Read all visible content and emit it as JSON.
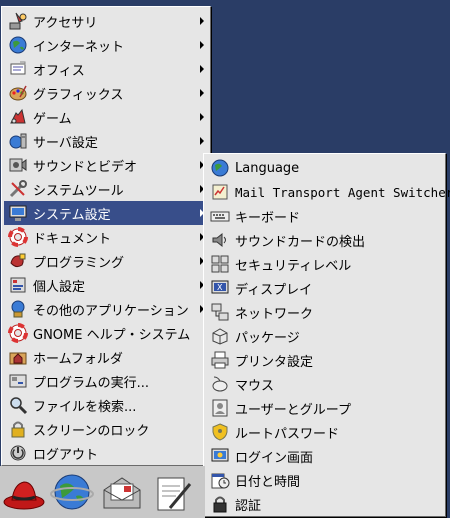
{
  "main_menu": {
    "items": [
      {
        "label": "アクセサリ",
        "icon": "accessories-icon",
        "submenu": true
      },
      {
        "label": "インターネット",
        "icon": "internet-globe-icon",
        "submenu": true
      },
      {
        "label": "オフィス",
        "icon": "office-icon",
        "submenu": true
      },
      {
        "label": "グラフィックス",
        "icon": "graphics-palette-icon",
        "submenu": true
      },
      {
        "label": "ゲーム",
        "icon": "games-icon",
        "submenu": true
      },
      {
        "label": "サーバ設定",
        "icon": "server-settings-icon",
        "submenu": true
      },
      {
        "label": "サウンドとビデオ",
        "icon": "sound-video-icon",
        "submenu": true
      },
      {
        "label": "システムツール",
        "icon": "system-tools-icon",
        "submenu": true
      },
      {
        "label": "システム設定",
        "icon": "system-settings-icon",
        "submenu": true,
        "selected": true
      },
      {
        "label": "ドキュメント",
        "icon": "documents-lifebuoy-icon",
        "submenu": true
      },
      {
        "label": "プログラミング",
        "icon": "programming-icon",
        "submenu": true
      },
      {
        "label": "個人設定",
        "icon": "preferences-icon",
        "submenu": true
      },
      {
        "label": "その他のアプリケーション",
        "icon": "other-apps-icon",
        "submenu": true
      },
      {
        "label": "GNOME ヘルプ・システム",
        "icon": "help-lifebuoy-icon",
        "submenu": false
      },
      {
        "label": "ホームフォルダ",
        "icon": "home-folder-icon",
        "submenu": false
      },
      {
        "label": "プログラムの実行...",
        "icon": "run-program-icon",
        "submenu": false
      },
      {
        "label": "ファイルを検索...",
        "icon": "search-icon",
        "submenu": false
      },
      {
        "label": "スクリーンのロック",
        "icon": "lock-icon",
        "submenu": false
      },
      {
        "label": "ログアウト",
        "icon": "logout-icon",
        "submenu": false
      }
    ]
  },
  "submenu": {
    "items": [
      {
        "label": "Language",
        "icon": "language-globe-icon"
      },
      {
        "label": "Mail Transport Agent Switcher",
        "icon": "mail-switcher-icon"
      },
      {
        "label": "キーボード",
        "icon": "keyboard-icon"
      },
      {
        "label": "サウンドカードの検出",
        "icon": "soundcard-icon"
      },
      {
        "label": "セキュリティレベル",
        "icon": "security-level-icon"
      },
      {
        "label": "ディスプレイ",
        "icon": "display-icon"
      },
      {
        "label": "ネットワーク",
        "icon": "network-icon"
      },
      {
        "label": "パッケージ",
        "icon": "packages-icon"
      },
      {
        "label": "プリンタ設定",
        "icon": "printer-icon"
      },
      {
        "label": "マウス",
        "icon": "mouse-icon"
      },
      {
        "label": "ユーザーとグループ",
        "icon": "users-groups-icon"
      },
      {
        "label": "ルートパスワード",
        "icon": "root-password-icon"
      },
      {
        "label": "ログイン画面",
        "icon": "login-screen-icon"
      },
      {
        "label": "日付と時間",
        "icon": "date-time-icon"
      },
      {
        "label": "認証",
        "icon": "authentication-icon"
      }
    ]
  },
  "panel": {
    "icons": [
      "redhat-menu-icon",
      "web-browser-icon",
      "email-icon",
      "writer-icon"
    ]
  },
  "colors": {
    "desktop": "#2a3d66",
    "menu_bg": "#e6e6e6",
    "selection": "#384e8a"
  }
}
